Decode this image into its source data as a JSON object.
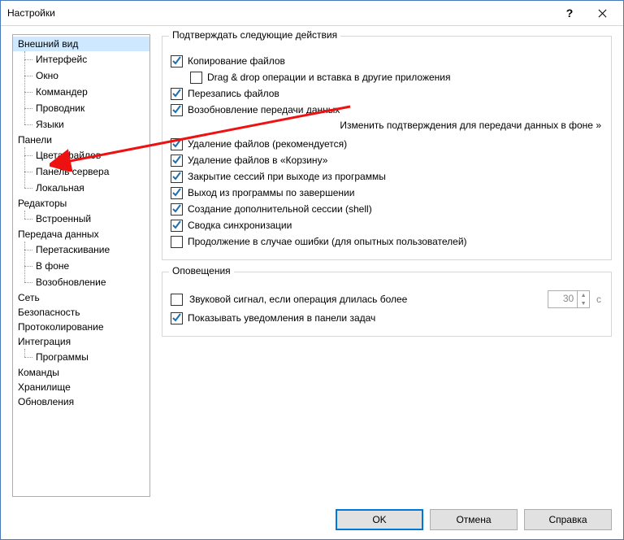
{
  "window": {
    "title": "Настройки"
  },
  "tree": {
    "groups": [
      {
        "label": "Внешний вид",
        "selected": true,
        "items": [
          {
            "label": "Интерфейс"
          },
          {
            "label": "Окно"
          },
          {
            "label": "Коммандер"
          },
          {
            "label": "Проводник"
          },
          {
            "label": "Языки"
          }
        ]
      },
      {
        "label": "Панели",
        "items": [
          {
            "label": "Цвета файлов"
          },
          {
            "label": "Панель сервера"
          },
          {
            "label": "Локальная"
          }
        ]
      },
      {
        "label": "Редакторы",
        "items": [
          {
            "label": "Встроенный"
          }
        ]
      },
      {
        "label": "Передача данных",
        "items": [
          {
            "label": "Перетаскивание"
          },
          {
            "label": "В фоне"
          },
          {
            "label": "Возобновление"
          }
        ]
      },
      {
        "label": "Сеть",
        "items": []
      },
      {
        "label": "Безопасность",
        "items": []
      },
      {
        "label": "Протоколирование",
        "items": []
      },
      {
        "label": "Интеграция",
        "items": [
          {
            "label": "Программы"
          }
        ]
      },
      {
        "label": "Команды",
        "items": []
      },
      {
        "label": "Хранилище",
        "items": []
      },
      {
        "label": "Обновления",
        "items": []
      }
    ]
  },
  "confirm": {
    "legend": "Подтверждать следующие действия",
    "items": [
      {
        "label": "Копирование файлов",
        "checked": true
      },
      {
        "label": "Drag & drop операции и вставка в другие приложения",
        "checked": false,
        "indent": true
      },
      {
        "label": "Перезапись файлов",
        "checked": true
      },
      {
        "label": "Возобновление передачи данных",
        "checked": true
      },
      {
        "label": "Удаление файлов (рекомендуется)",
        "checked": true
      },
      {
        "label": "Удаление файлов в «Корзину»",
        "checked": true
      },
      {
        "label": "Закрытие сессий при выходе из программы",
        "checked": true
      },
      {
        "label": "Выход из программы по завершении",
        "checked": true
      },
      {
        "label": "Создание дополнительной сессии (shell)",
        "checked": true
      },
      {
        "label": "Сводка синхронизации",
        "checked": true
      },
      {
        "label": "Продолжение в случае ошибки (для опытных пользователей)",
        "checked": false
      }
    ],
    "link": "Изменить подтверждения для передачи данных в фоне »"
  },
  "notifications": {
    "legend": "Оповещения",
    "sound": {
      "label": "Звуковой сигнал, если операция длилась более",
      "checked": false,
      "value": "30",
      "unit": "с"
    },
    "balloon": {
      "label": "Показывать уведомления в панели задач",
      "checked": true
    }
  },
  "buttons": {
    "ok": "OK",
    "cancel": "Отмена",
    "help": "Справка"
  }
}
